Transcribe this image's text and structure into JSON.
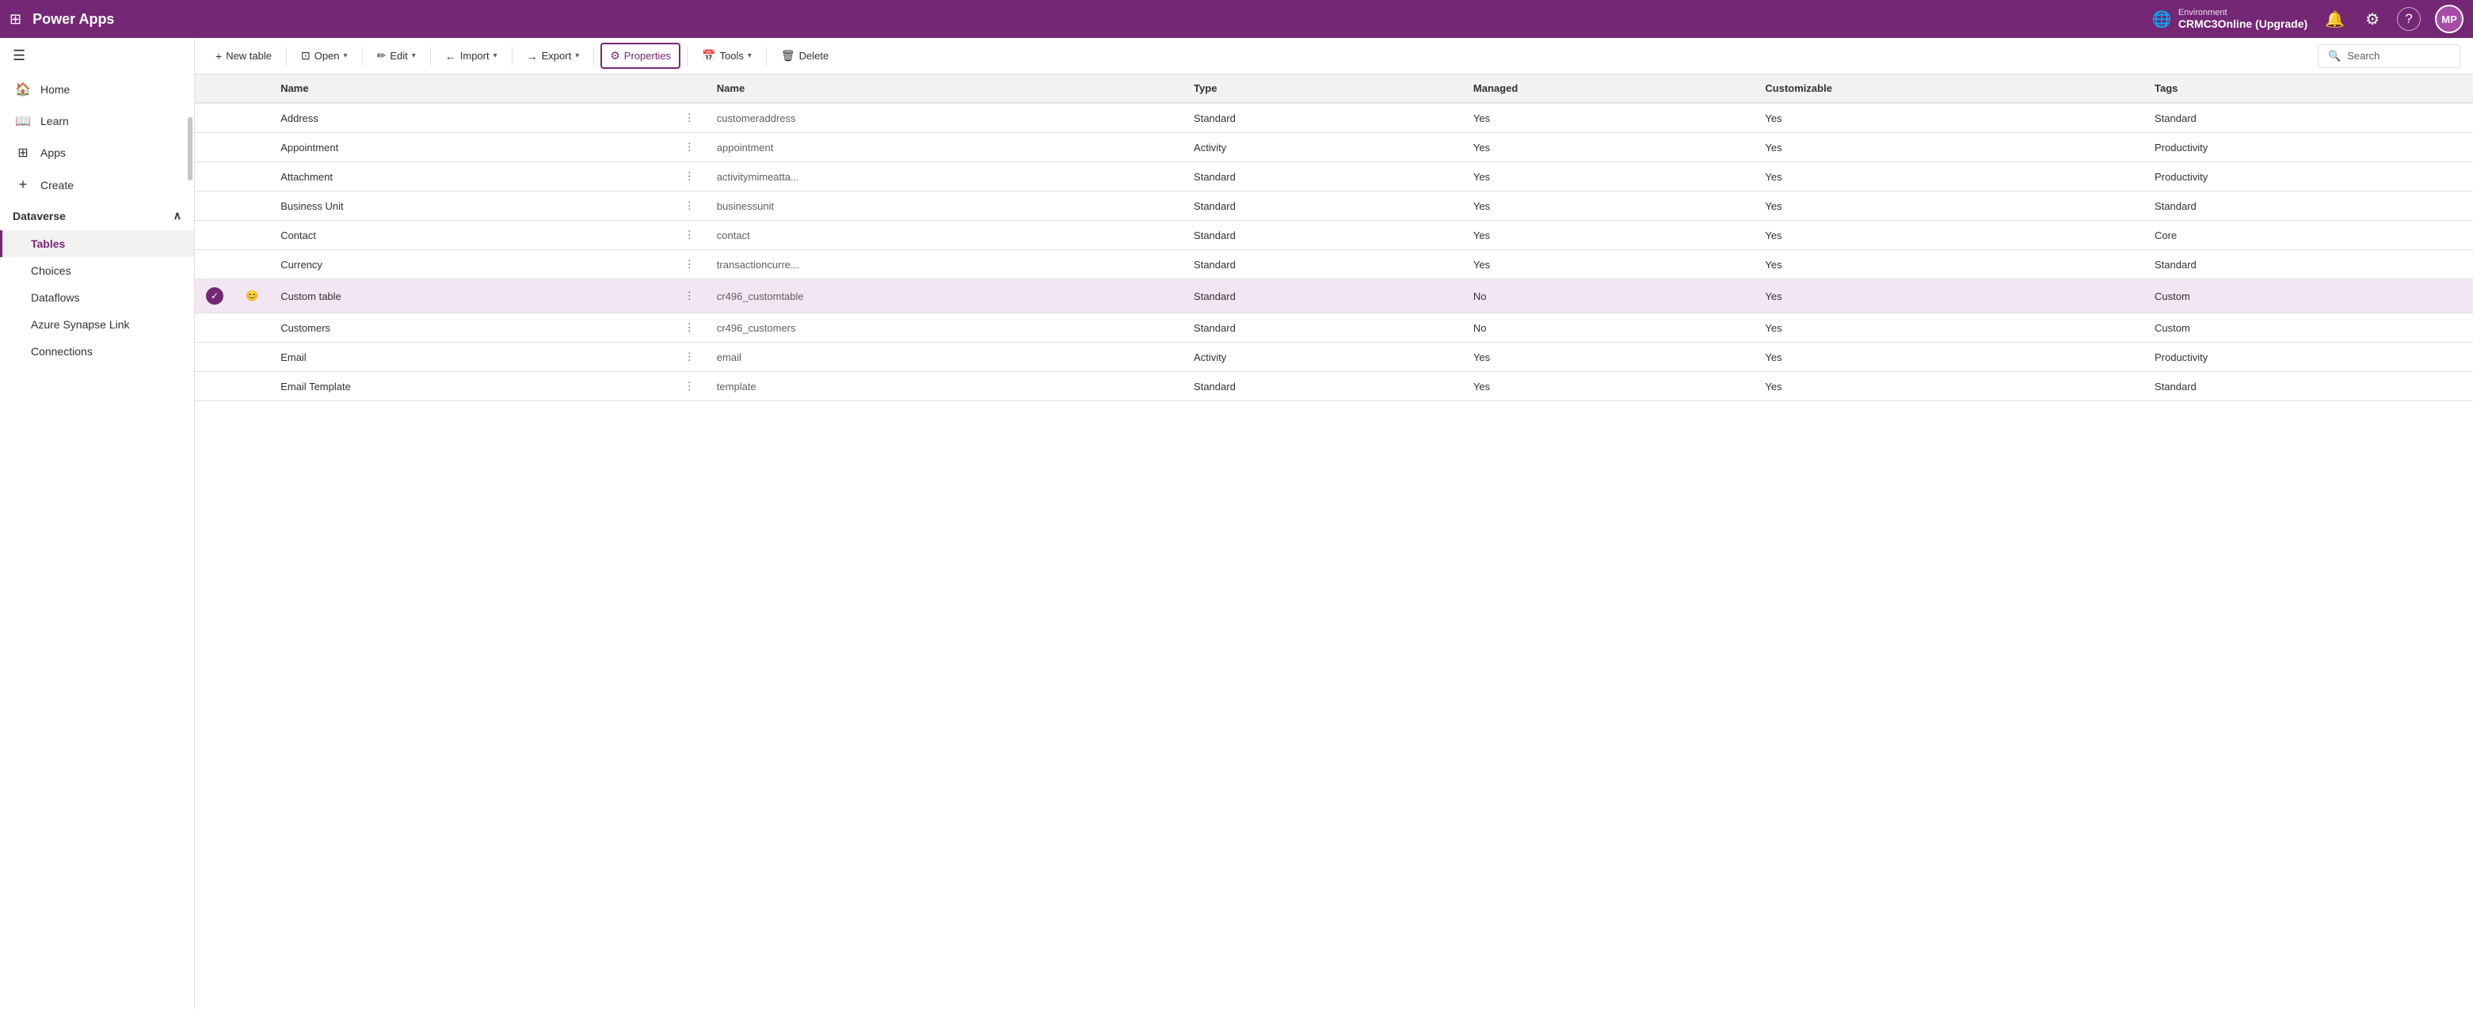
{
  "topNav": {
    "gridIconLabel": "⊞",
    "appName": "Power Apps",
    "environment": {
      "globeIcon": "🌐",
      "label": "Environment",
      "name": "CRMC3Online (Upgrade)"
    },
    "bellIcon": "🔔",
    "settingsIcon": "⚙",
    "helpIcon": "?",
    "avatarLabel": "MP"
  },
  "sidebar": {
    "hamburgerIcon": "☰",
    "items": [
      {
        "id": "home",
        "icon": "🏠",
        "label": "Home",
        "active": false
      },
      {
        "id": "learn",
        "icon": "📖",
        "label": "Learn",
        "active": false
      },
      {
        "id": "apps",
        "icon": "⊞",
        "label": "Apps",
        "active": false
      },
      {
        "id": "create",
        "icon": "+",
        "label": "Create",
        "active": false
      }
    ],
    "dataverse": {
      "label": "Dataverse",
      "chevron": "∧",
      "subitems": [
        {
          "id": "tables",
          "label": "Tables",
          "active": true
        },
        {
          "id": "choices",
          "label": "Choices",
          "active": false
        },
        {
          "id": "dataflows",
          "label": "Dataflows",
          "active": false
        },
        {
          "id": "azure-synapse",
          "label": "Azure Synapse Link",
          "active": false
        },
        {
          "id": "connections",
          "label": "Connections",
          "active": false
        }
      ]
    }
  },
  "toolbar": {
    "newTableLabel": "New table",
    "newTableIcon": "+",
    "openLabel": "Open",
    "openIcon": "⊡",
    "openChevron": "▾",
    "editLabel": "Edit",
    "editIcon": "✏",
    "editChevron": "▾",
    "importLabel": "Import",
    "importIcon": "←",
    "importChevron": "▾",
    "exportLabel": "Export",
    "exportIcon": "→",
    "exportChevron": "▾",
    "propertiesLabel": "Properties",
    "propertiesIcon": "⚙",
    "toolsLabel": "Tools",
    "toolsIcon": "📅",
    "toolsChevron": "▾",
    "deleteLabel": "Delete",
    "deleteIcon": "🗑",
    "searchPlaceholder": "Search",
    "searchIcon": "🔍"
  },
  "table": {
    "columns": [
      "Name",
      "",
      "Name",
      "Type",
      "Managed",
      "Customizable",
      "Tags"
    ],
    "rows": [
      {
        "id": "address",
        "name": "Address",
        "techName": "customeraddress",
        "type": "Standard",
        "managed": "Yes",
        "customizable": "Yes",
        "tags": "Standard",
        "selected": false,
        "hasEmoji": false
      },
      {
        "id": "appointment",
        "name": "Appointment",
        "techName": "appointment",
        "type": "Activity",
        "managed": "Yes",
        "customizable": "Yes",
        "tags": "Productivity",
        "selected": false,
        "hasEmoji": false
      },
      {
        "id": "attachment",
        "name": "Attachment",
        "techName": "activitymimeatta...",
        "type": "Standard",
        "managed": "Yes",
        "customizable": "Yes",
        "tags": "Productivity",
        "selected": false,
        "hasEmoji": false
      },
      {
        "id": "business-unit",
        "name": "Business Unit",
        "techName": "businessunit",
        "type": "Standard",
        "managed": "Yes",
        "customizable": "Yes",
        "tags": "Standard",
        "selected": false,
        "hasEmoji": false
      },
      {
        "id": "contact",
        "name": "Contact",
        "techName": "contact",
        "type": "Standard",
        "managed": "Yes",
        "customizable": "Yes",
        "tags": "Core",
        "selected": false,
        "hasEmoji": false
      },
      {
        "id": "currency",
        "name": "Currency",
        "techName": "transactioncurre...",
        "type": "Standard",
        "managed": "Yes",
        "customizable": "Yes",
        "tags": "Standard",
        "selected": false,
        "hasEmoji": false
      },
      {
        "id": "custom-table",
        "name": "Custom table",
        "techName": "cr496_customtable",
        "type": "Standard",
        "managed": "No",
        "customizable": "Yes",
        "tags": "Custom",
        "selected": true,
        "hasEmoji": true,
        "emoji": "😊"
      },
      {
        "id": "customers",
        "name": "Customers",
        "techName": "cr496_customers",
        "type": "Standard",
        "managed": "No",
        "customizable": "Yes",
        "tags": "Custom",
        "selected": false,
        "hasEmoji": false
      },
      {
        "id": "email",
        "name": "Email",
        "techName": "email",
        "type": "Activity",
        "managed": "Yes",
        "customizable": "Yes",
        "tags": "Productivity",
        "selected": false,
        "hasEmoji": false
      },
      {
        "id": "email-template",
        "name": "Email Template",
        "techName": "template",
        "type": "Standard",
        "managed": "Yes",
        "customizable": "Yes",
        "tags": "Standard",
        "selected": false,
        "hasEmoji": false
      }
    ]
  }
}
